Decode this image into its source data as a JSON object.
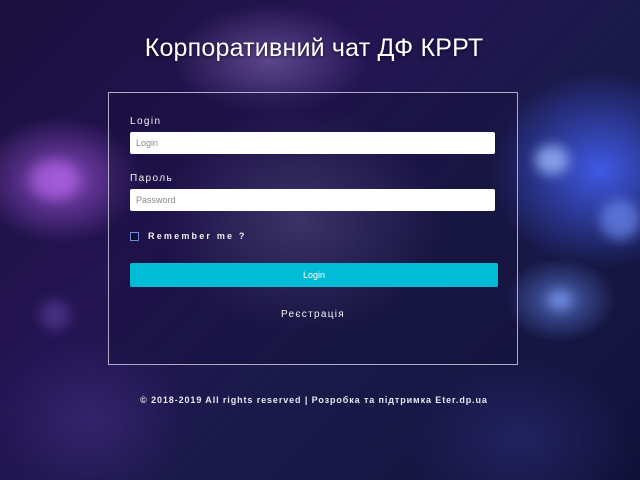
{
  "page": {
    "title": "Корпоративний чат ДФ КРРТ"
  },
  "form": {
    "login_label": "Login",
    "login_placeholder": "Login",
    "password_label": "Пароль",
    "password_placeholder": "Password",
    "remember_label": "Remember me ?",
    "remember_checked": false,
    "login_button": "Login",
    "register_link": "Реєстрація"
  },
  "footer": {
    "text": "© 2018-2019 All rights reserved | Розробка та підтримка Eter.dp.ua"
  },
  "colors": {
    "accent": "#00bcd4",
    "checkbox_border": "#6a8fd6",
    "panel_border": "#c8c8dc"
  }
}
